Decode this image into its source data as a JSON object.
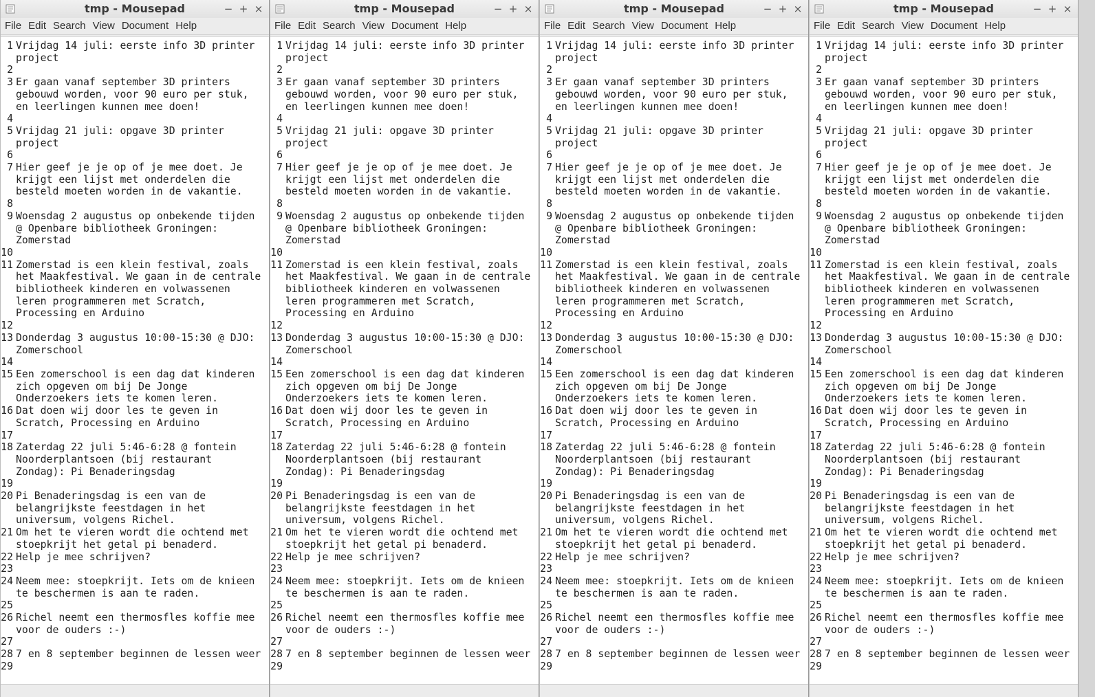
{
  "window": {
    "title": "tmp - Mousepad",
    "controls": {
      "minimize": "−",
      "maximize": "+",
      "close": "×"
    },
    "menu": [
      "File",
      "Edit",
      "Search",
      "View",
      "Document",
      "Help"
    ]
  },
  "window_count": 4,
  "icons": {
    "app": "text-editor-icon",
    "minimize": "minimize-icon",
    "maximize": "maximize-icon",
    "close": "close-icon"
  },
  "document": {
    "lines": [
      {
        "n": "1",
        "t": "Vrijdag 14 juli: eerste info 3D printer project"
      },
      {
        "n": "2",
        "t": ""
      },
      {
        "n": "3",
        "t": "Er gaan vanaf september 3D printers gebouwd worden, voor 90 euro per stuk, en leerlingen kunnen mee doen!"
      },
      {
        "n": "4",
        "t": ""
      },
      {
        "n": "5",
        "t": "Vrijdag 21 juli: opgave 3D printer project"
      },
      {
        "n": "6",
        "t": ""
      },
      {
        "n": "7",
        "t": "Hier geef je je op of je mee doet. Je krijgt een lijst met onderdelen die besteld moeten worden in de vakantie."
      },
      {
        "n": "8",
        "t": ""
      },
      {
        "n": "9",
        "t": "Woensdag 2 augustus op onbekende tijden @ Openbare bibliotheek Groningen: Zomerstad"
      },
      {
        "n": "10",
        "t": ""
      },
      {
        "n": "11",
        "t": "Zomerstad is een klein festival, zoals het Maakfestival. We gaan in de centrale bibliotheek kinderen en volwassenen leren programmeren met Scratch, Processing en Arduino"
      },
      {
        "n": "12",
        "t": ""
      },
      {
        "n": "13",
        "t": "Donderdag 3 augustus 10:00-15:30 @ DJO: Zomerschool"
      },
      {
        "n": "14",
        "t": ""
      },
      {
        "n": "15",
        "t": "Een zomerschool is een dag dat kinderen zich opgeven om bij De Jonge Onderzoekers iets te komen leren."
      },
      {
        "n": "16",
        "t": "Dat doen wij door les te geven in Scratch, Processing en Arduino"
      },
      {
        "n": "17",
        "t": ""
      },
      {
        "n": "18",
        "t": "Zaterdag 22 juli 5:46-6:28 @ fontein Noorderplantsoen (bij restaurant Zondag): Pi Benaderingsdag"
      },
      {
        "n": "19",
        "t": ""
      },
      {
        "n": "20",
        "t": "Pi Benaderingsdag is een van de belangrijkste feestdagen in het universum, volgens Richel."
      },
      {
        "n": "21",
        "t": "Om het te vieren wordt die ochtend met stoepkrijt het getal pi benaderd."
      },
      {
        "n": "22",
        "t": "Help je mee schrijven?"
      },
      {
        "n": "23",
        "t": ""
      },
      {
        "n": "24",
        "t": "Neem mee: stoepkrijt. Iets om de knieen te beschermen is aan te raden."
      },
      {
        "n": "25",
        "t": ""
      },
      {
        "n": "26",
        "t": "Richel neemt een thermosfles koffie mee voor de ouders :-)"
      },
      {
        "n": "27",
        "t": ""
      },
      {
        "n": "28",
        "t": "7 en 8 september beginnen de lessen weer"
      },
      {
        "n": "29",
        "t": ""
      }
    ]
  }
}
